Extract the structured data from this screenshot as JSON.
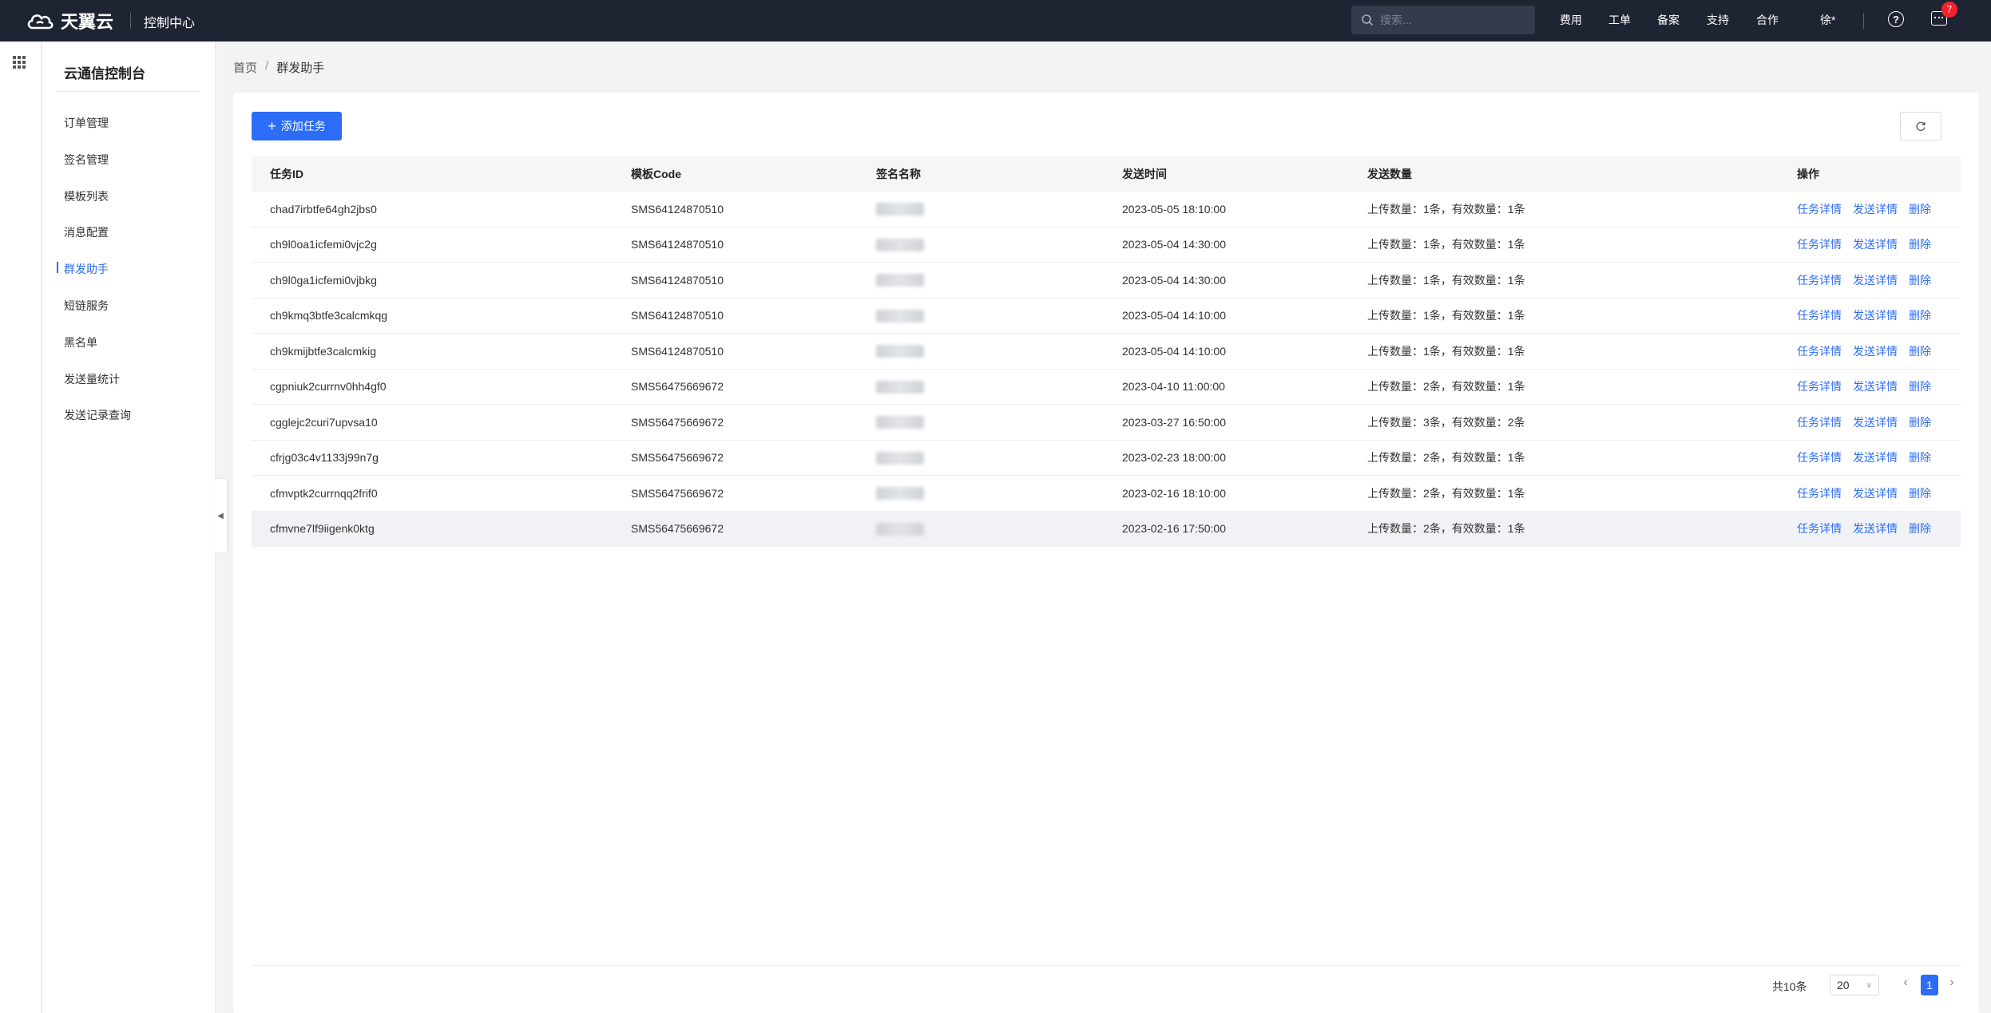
{
  "topbar": {
    "logo_text": "天翼云",
    "console_label": "控制中心",
    "search_placeholder": "搜索...",
    "nav": [
      "费用",
      "工单",
      "备案",
      "支持",
      "合作"
    ],
    "user": "徐*",
    "notification_count": "7"
  },
  "sidebar": {
    "title": "云通信控制台",
    "items": [
      {
        "label": "订单管理"
      },
      {
        "label": "签名管理"
      },
      {
        "label": "模板列表"
      },
      {
        "label": "消息配置"
      },
      {
        "label": "群发助手"
      },
      {
        "label": "短链服务"
      },
      {
        "label": "黑名单"
      },
      {
        "label": "发送量统计"
      },
      {
        "label": "发送记录查询"
      }
    ],
    "active_index": 4
  },
  "breadcrumb": {
    "home": "首页",
    "separator": "/",
    "current": "群发助手"
  },
  "toolbar": {
    "add_label": "添加任务"
  },
  "table": {
    "headers": [
      "任务ID",
      "模板Code",
      "签名名称",
      "发送时间",
      "发送数量",
      "操作"
    ],
    "ops": [
      "任务详情",
      "发送详情",
      "删除"
    ],
    "rows": [
      {
        "id": "chad7irbtfe64gh2jbs0",
        "code": "SMS64124870510",
        "time": "2023-05-05 18:10:00",
        "count": "上传数量：1条，有效数量：1条"
      },
      {
        "id": "ch9l0oa1icfemi0vjc2g",
        "code": "SMS64124870510",
        "time": "2023-05-04 14:30:00",
        "count": "上传数量：1条，有效数量：1条"
      },
      {
        "id": "ch9l0ga1icfemi0vjbkg",
        "code": "SMS64124870510",
        "time": "2023-05-04 14:30:00",
        "count": "上传数量：1条，有效数量：1条"
      },
      {
        "id": "ch9kmq3btfe3calcmkqg",
        "code": "SMS64124870510",
        "time": "2023-05-04 14:10:00",
        "count": "上传数量：1条，有效数量：1条"
      },
      {
        "id": "ch9kmijbtfe3calcmkig",
        "code": "SMS64124870510",
        "time": "2023-05-04 14:10:00",
        "count": "上传数量：1条，有效数量：1条"
      },
      {
        "id": "cgpniuk2currnv0hh4gf0",
        "code": "SMS56475669672",
        "time": "2023-04-10 11:00:00",
        "count": "上传数量：2条，有效数量：1条"
      },
      {
        "id": "cgglejc2curi7upvsa10",
        "code": "SMS56475669672",
        "time": "2023-03-27 16:50:00",
        "count": "上传数量：3条，有效数量：2条"
      },
      {
        "id": "cfrjg03c4v1133j99n7g",
        "code": "SMS56475669672",
        "time": "2023-02-23 18:00:00",
        "count": "上传数量：2条，有效数量：1条"
      },
      {
        "id": "cfmvptk2currnqq2frif0",
        "code": "SMS56475669672",
        "time": "2023-02-16 18:10:00",
        "count": "上传数量：2条，有效数量：1条"
      },
      {
        "id": "cfmvne7lf9iigenk0ktg",
        "code": "SMS56475669672",
        "time": "2023-02-16 17:50:00",
        "count": "上传数量：2条，有效数量：1条"
      }
    ]
  },
  "pagination": {
    "total": "共10条",
    "page_size": "20",
    "current_page": "1"
  },
  "colors": {
    "topbar_bg": "#1f2433",
    "accent": "#2d6cf6",
    "badge": "#f5222d"
  }
}
